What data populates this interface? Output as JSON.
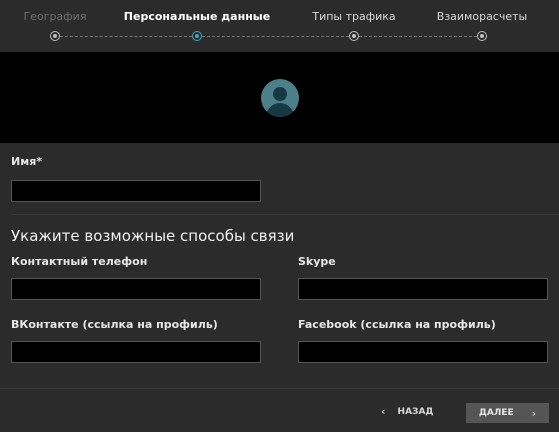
{
  "stepper": {
    "steps": [
      {
        "label": "География",
        "state": "done"
      },
      {
        "label": "Персональные данные",
        "state": "active"
      },
      {
        "label": "Типы трафика",
        "state": "upcoming"
      },
      {
        "label": "Взаиморасчеты",
        "state": "upcoming"
      }
    ],
    "accent_color": "#3fa4b9"
  },
  "profile": {
    "avatar_icon": "user-avatar-icon"
  },
  "form": {
    "name_label": "Имя*",
    "name_value": "",
    "contacts_title": "Укажите возможные способы связи",
    "phone_label": "Контактный телефон",
    "phone_value": "",
    "skype_label": "Skype",
    "skype_value": "",
    "vk_label": "ВКонтакте (ссылка на профиль)",
    "vk_value": "",
    "facebook_label": "Facebook (ссылка на профиль)",
    "facebook_value": ""
  },
  "footer": {
    "back_label": "НАЗАД",
    "next_label": "ДАЛЕЕ"
  }
}
